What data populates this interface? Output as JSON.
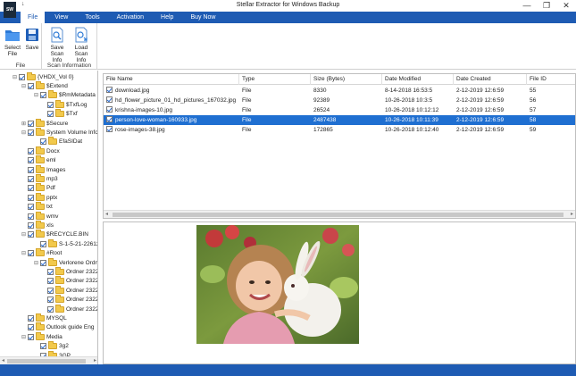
{
  "app": {
    "title": "Stellar Extractor for Windows Backup",
    "logo_text": "SW",
    "qat_glyph": "↓"
  },
  "window_controls": {
    "minimize": "—",
    "restore": "❐",
    "close": "✕"
  },
  "menu": {
    "items": [
      {
        "label": "File",
        "active": true
      },
      {
        "label": "View"
      },
      {
        "label": "Tools"
      },
      {
        "label": "Activation"
      },
      {
        "label": "Help"
      },
      {
        "label": "Buy Now"
      }
    ]
  },
  "ribbon": {
    "file_group": {
      "label": "File",
      "select_file": "Select File",
      "save": "Save"
    },
    "scan_group": {
      "label": "Scan Information",
      "save_scan_info": "Save Scan Info",
      "load_scan_info": "Load Scan Info"
    }
  },
  "tree": {
    "items": [
      {
        "label": "{VHDX_Vol 0}",
        "level": 0,
        "exp": "⊟"
      },
      {
        "label": "$Extend",
        "level": 1,
        "exp": "⊟"
      },
      {
        "label": "$RmMetadata",
        "level": 2,
        "exp": "⊟"
      },
      {
        "label": "$TxfLog",
        "level": 3,
        "exp": ""
      },
      {
        "label": "$Txf",
        "level": 3,
        "exp": ""
      },
      {
        "label": "$Secure",
        "level": 1,
        "exp": "⊞"
      },
      {
        "label": "System Volume Infor",
        "level": 1,
        "exp": "⊟"
      },
      {
        "label": "EfaSIDat",
        "level": 2,
        "exp": ""
      },
      {
        "label": "Docx",
        "level": 1,
        "exp": ""
      },
      {
        "label": "eml",
        "level": 1,
        "exp": ""
      },
      {
        "label": "Images",
        "level": 1,
        "exp": ""
      },
      {
        "label": "mp3",
        "level": 1,
        "exp": ""
      },
      {
        "label": "Pdf",
        "level": 1,
        "exp": ""
      },
      {
        "label": "pptx",
        "level": 1,
        "exp": ""
      },
      {
        "label": "txt",
        "level": 1,
        "exp": ""
      },
      {
        "label": "wmv",
        "level": 1,
        "exp": ""
      },
      {
        "label": "xls",
        "level": 1,
        "exp": ""
      },
      {
        "label": "$RECYCLE.BIN",
        "level": 1,
        "exp": "⊟"
      },
      {
        "label": "S-1-5-21-2261286",
        "level": 2,
        "exp": ""
      },
      {
        "label": "#Root",
        "level": 1,
        "exp": "⊟"
      },
      {
        "label": "Verlorene Ordner",
        "level": 2,
        "exp": "⊟"
      },
      {
        "label": "Ordner 23223",
        "level": 3,
        "exp": ""
      },
      {
        "label": "Ordner 23223",
        "level": 3,
        "exp": ""
      },
      {
        "label": "Ordner 23223",
        "level": 3,
        "exp": ""
      },
      {
        "label": "Ordner 23223",
        "level": 3,
        "exp": ""
      },
      {
        "label": "Ordner 23223",
        "level": 3,
        "exp": ""
      },
      {
        "label": "MYSQL",
        "level": 1,
        "exp": ""
      },
      {
        "label": "Outlook guide Eng",
        "level": 1,
        "exp": ""
      },
      {
        "label": "Media",
        "level": 1,
        "exp": "⊟"
      },
      {
        "label": "3g2",
        "level": 2,
        "exp": ""
      },
      {
        "label": "3GP",
        "level": 2,
        "exp": ""
      }
    ]
  },
  "table": {
    "columns": [
      "File Name",
      "Type",
      "Size (Bytes)",
      "Date Modified",
      "Date Created",
      "File ID"
    ],
    "rows": [
      {
        "name": "download.jpg",
        "type": "File",
        "size": "8330",
        "modified": "8-14-2018  16:53:5",
        "created": "2-12-2019  12:6:59",
        "id": "55",
        "selected": false
      },
      {
        "name": "hd_flower_picture_01_hd_pictures_167032.jpg",
        "type": "File",
        "size": "92389",
        "modified": "10-26-2018  10:3:5",
        "created": "2-12-2019  12:6:59",
        "id": "56",
        "selected": false
      },
      {
        "name": "krishna-images-10.jpg",
        "type": "File",
        "size": "26524",
        "modified": "10-26-2018  10:12:12",
        "created": "2-12-2019  12:6:59",
        "id": "57",
        "selected": false
      },
      {
        "name": "person-love-woman-160933.jpg",
        "type": "File",
        "size": "2487438",
        "modified": "10-26-2018  10:11:39",
        "created": "2-12-2019  12:6:59",
        "id": "58",
        "selected": true
      },
      {
        "name": "rose-images-38.jpg",
        "type": "File",
        "size": "172865",
        "modified": "10-26-2018  10:12:40",
        "created": "2-12-2019  12:6:59",
        "id": "59",
        "selected": false
      }
    ]
  },
  "scroll": {
    "left": "◂",
    "right": "▸"
  },
  "colors": {
    "accent": "#1e5bb3",
    "selection": "#1f6fd1"
  }
}
